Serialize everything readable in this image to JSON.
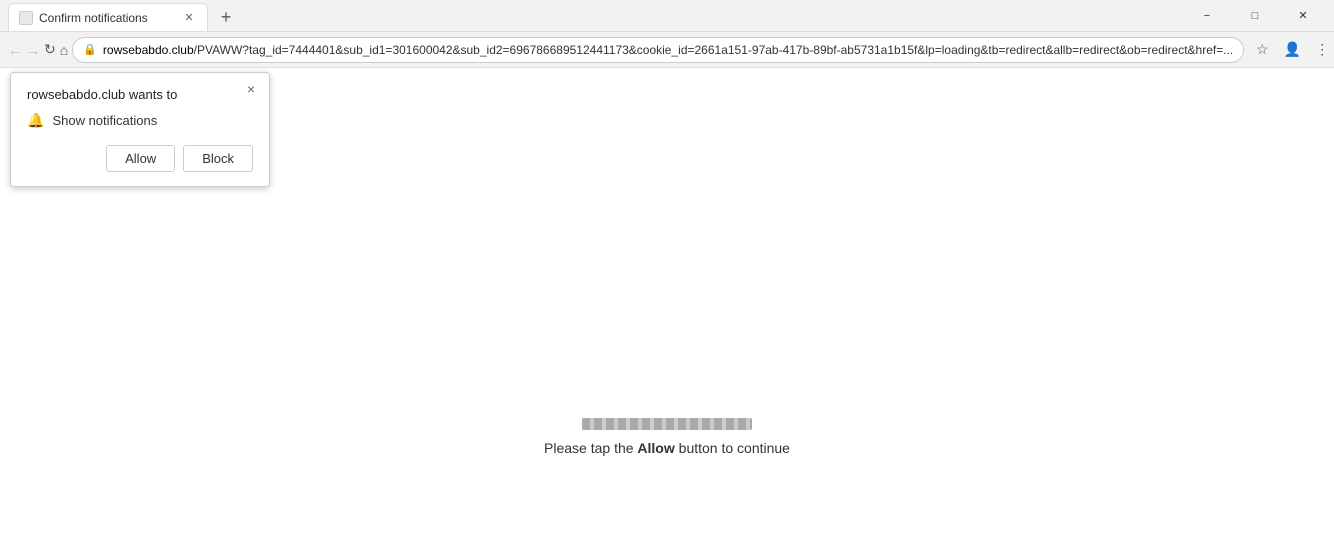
{
  "titlebar": {
    "tab": {
      "title": "Confirm notifications",
      "favicon_alt": "page-favicon"
    },
    "new_tab_label": "+",
    "window_controls": {
      "minimize": "−",
      "maximize": "□",
      "close": "✕"
    }
  },
  "navbar": {
    "back": "←",
    "forward": "→",
    "refresh": "↻",
    "home": "⌂",
    "lock": "🔒",
    "address": "rowsebabdo.club/PVAWW?tag_id=7444401&sub_id1=301600042&sub_id2=696786689512441173&cookie_id=2661a151-97ab-417b-89bf-ab5731a1b15f&lp=loading&tb=redirect&allb=redirect&ob=redirect&href=...",
    "address_domain": "rowsebabdo.club",
    "bookmark_icon": "☆",
    "profile_icon": "👤",
    "menu_icon": "⋮"
  },
  "popup": {
    "site_name": "rowsebabdo.club",
    "wants_to": "wants to",
    "title": "rowsebabdo.club wants to",
    "close_label": "×",
    "permission_label": "Show notifications",
    "allow_label": "Allow",
    "block_label": "Block"
  },
  "page": {
    "loading_text_before": "Please tap the ",
    "loading_text_bold": "Allow",
    "loading_text_after": " button to continue"
  }
}
